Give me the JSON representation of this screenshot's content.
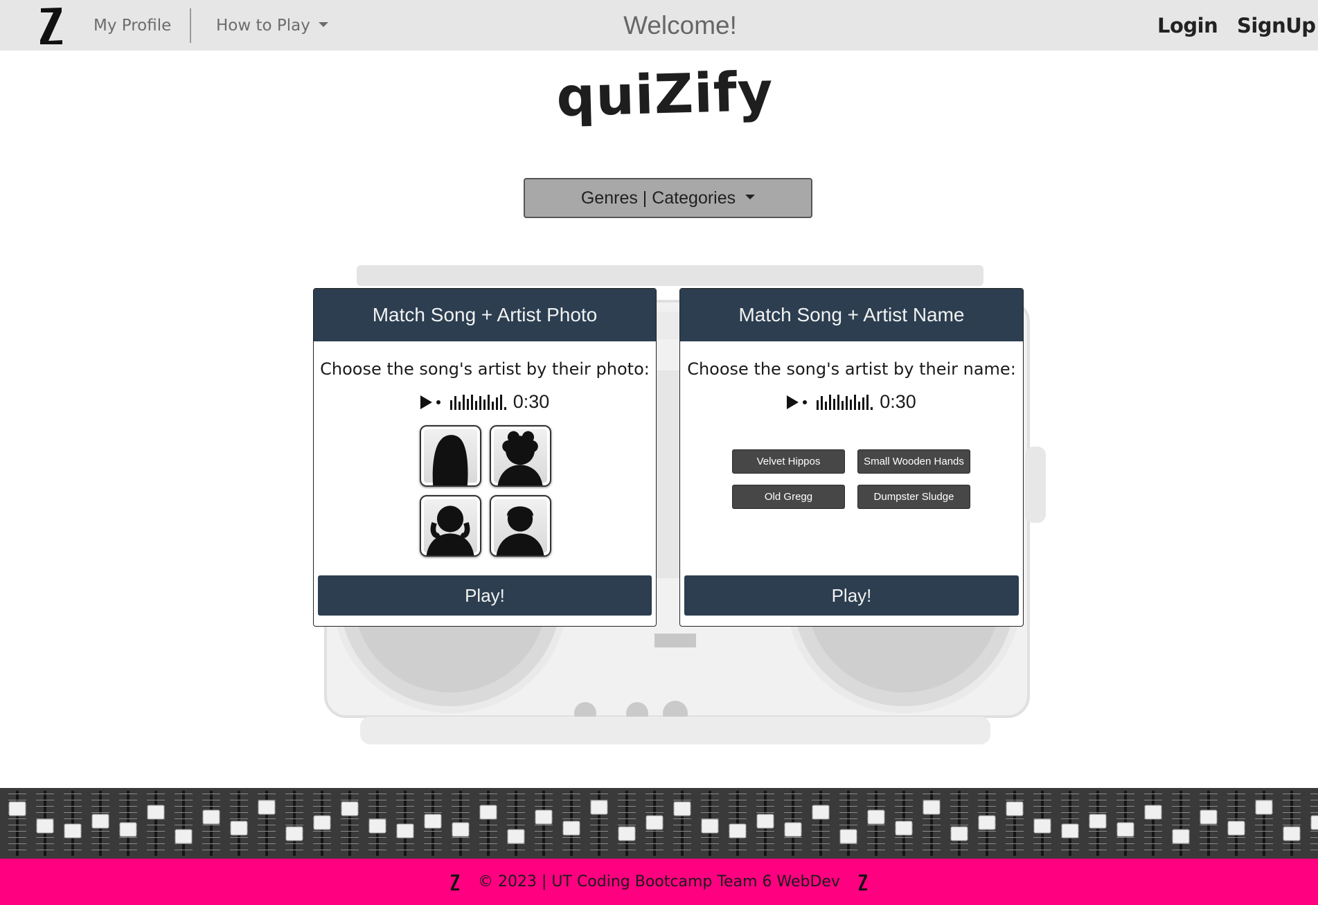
{
  "navbar": {
    "logo_icon": "z-logo-icon",
    "profile_label": "My Profile",
    "howto_label": "How to Play",
    "welcome": "Welcome!",
    "login_label": "Login",
    "signup_label": "SignUp"
  },
  "brand": {
    "title": "quiZify"
  },
  "genre_dropdown": {
    "label": "Genres | Categories"
  },
  "cards": [
    {
      "title": "Match Song + Artist Photo",
      "prompt": "Choose the song's artist by their photo:",
      "player_time": "0:30",
      "photos": [
        "artist-photo-silhouette-long-hair",
        "artist-photo-silhouette-curly-hair",
        "artist-photo-silhouette-messy-hair",
        "artist-photo-silhouette-short-hair"
      ],
      "play_label": "Play!"
    },
    {
      "title": "Match Song + Artist Name",
      "prompt": "Choose the song's artist by their name:",
      "player_time": "0:30",
      "options": [
        "Velvet Hippos",
        "Small Wooden Hands",
        "Old Gregg",
        "Dumpster Sludge"
      ],
      "play_label": "Play!"
    }
  ],
  "footer": {
    "text": "© 2023 | UT Coding Bootcamp Team 6 WebDev",
    "background": "#ff0080",
    "logo_icon": "z-logo-icon"
  },
  "colors": {
    "navbar": "#e6e6e6",
    "card_header": "#2c3e50",
    "name_button": "#474747",
    "genre_button": "#a8a8a8"
  }
}
